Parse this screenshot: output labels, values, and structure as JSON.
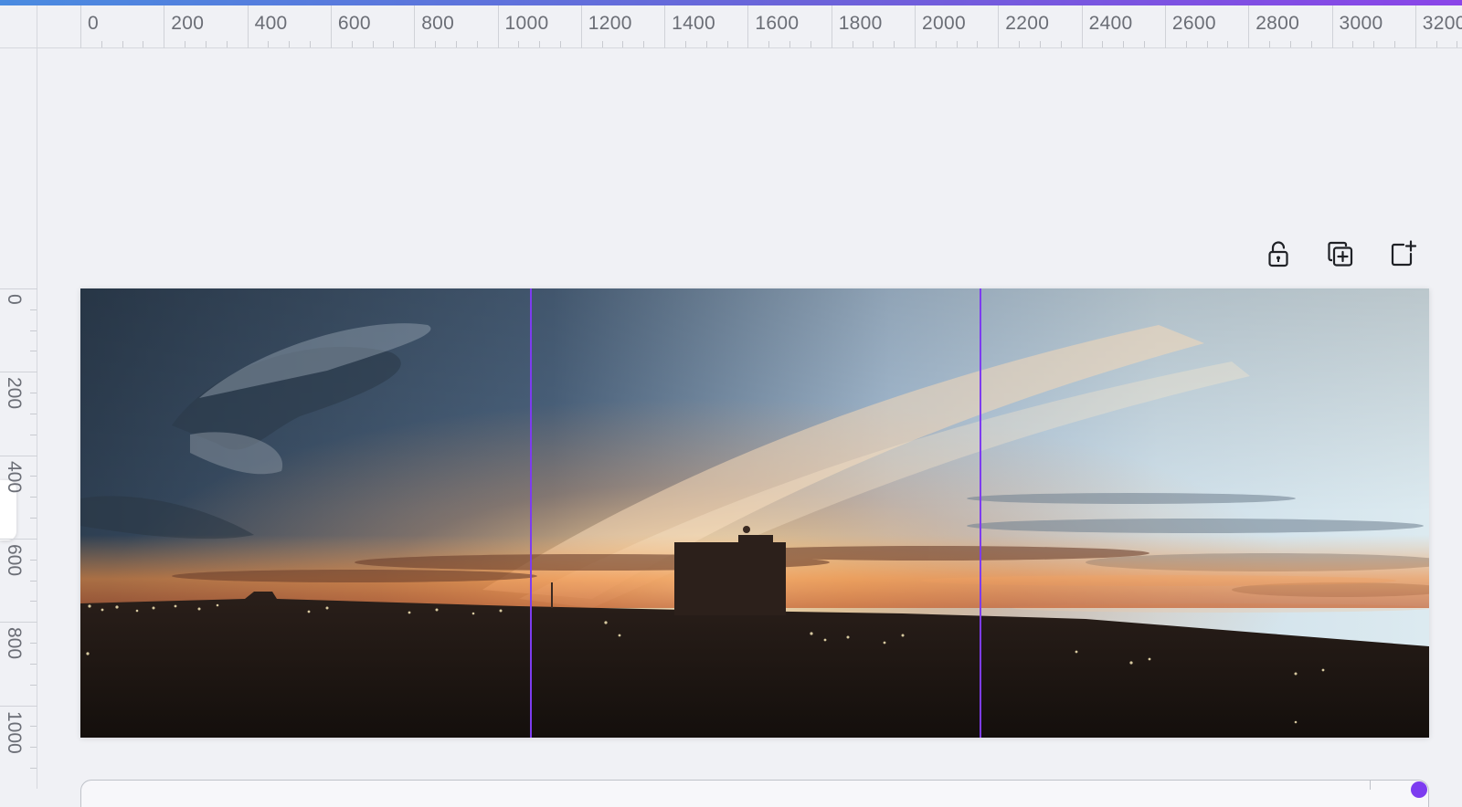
{
  "rulers": {
    "horizontal_labels": [
      "0",
      "200",
      "400",
      "600",
      "800",
      "1000",
      "1200",
      "1400",
      "1600",
      "1800",
      "2000",
      "2200",
      "2400",
      "2600",
      "2800",
      "3000",
      "3200"
    ],
    "vertical_labels": [
      "0",
      "200",
      "400",
      "600",
      "800",
      "1000"
    ]
  },
  "toolbar": {
    "lock_icon": "unlock-icon",
    "duplicate_icon": "duplicate-page-icon",
    "add_icon": "add-page-icon"
  },
  "page": {
    "image": "sunset-panorama",
    "guides": 2
  },
  "colors": {
    "accent": "#7d3cf0",
    "ruler_text": "#6b6e76",
    "background": "#f0f1f5"
  }
}
